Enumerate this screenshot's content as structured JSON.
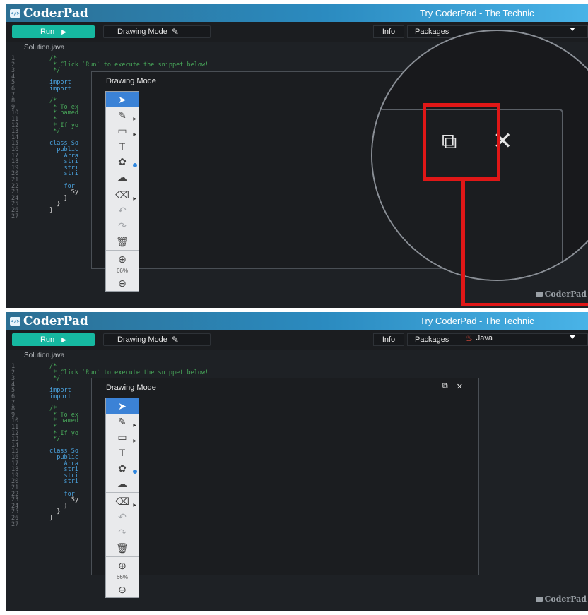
{
  "app": {
    "logo_text": "CoderPad",
    "logo_badge": "</>",
    "tagline": "Try CoderPad - The Technic"
  },
  "toolbar": {
    "run_label": "Run",
    "drawing_label": "Drawing Mode",
    "info_label": "Info",
    "packages_label": "Packages",
    "language": "Java"
  },
  "file_tab": "Solution.java",
  "code_lines": [
    {
      "n": "1",
      "t": "/*",
      "c": "com"
    },
    {
      "n": "2",
      "t": " * Click `Run` to execute the snippet below!",
      "c": "com"
    },
    {
      "n": "3",
      "t": " */",
      "c": "com"
    },
    {
      "n": "4",
      "t": "",
      "c": "pl"
    },
    {
      "n": "5",
      "t": "import",
      "c": "kw"
    },
    {
      "n": "6",
      "t": "import",
      "c": "kw"
    },
    {
      "n": "7",
      "t": "",
      "c": "pl"
    },
    {
      "n": "8",
      "t": "/*",
      "c": "com"
    },
    {
      "n": "9",
      "t": " * To ex",
      "c": "com"
    },
    {
      "n": "10",
      "t": " * named",
      "c": "com"
    },
    {
      "n": "11",
      "t": " *",
      "c": "com"
    },
    {
      "n": "12",
      "t": " * If yo",
      "c": "com"
    },
    {
      "n": "13",
      "t": " */",
      "c": "com"
    },
    {
      "n": "14",
      "t": "",
      "c": "pl"
    },
    {
      "n": "15",
      "t": "class So",
      "c": "kw"
    },
    {
      "n": "16",
      "t": "  public",
      "c": "kw"
    },
    {
      "n": "17",
      "t": "    Arra",
      "c": "kw"
    },
    {
      "n": "18",
      "t": "    stri",
      "c": "kw"
    },
    {
      "n": "19",
      "t": "    stri",
      "c": "kw"
    },
    {
      "n": "20",
      "t": "    stri",
      "c": "kw"
    },
    {
      "n": "21",
      "t": "",
      "c": "pl"
    },
    {
      "n": "22",
      "t": "    for",
      "c": "kw"
    },
    {
      "n": "23",
      "t": "      Sy",
      "c": "pl"
    },
    {
      "n": "24",
      "t": "    }",
      "c": "pl"
    },
    {
      "n": "25",
      "t": "  }",
      "c": "pl"
    },
    {
      "n": "26",
      "t": "}",
      "c": "pl"
    },
    {
      "n": "27",
      "t": "",
      "c": "pl"
    }
  ],
  "drawing_modal": {
    "title": "Drawing Mode",
    "zoom_level": "66%",
    "popout_icon": "popout-icon",
    "close_icon": "close-icon",
    "tools": [
      "select-arrow-icon",
      "pencil-icon",
      "rectangle-icon",
      "text-icon",
      "palette-icon",
      "upload-cloud-icon",
      "eraser-icon",
      "undo-icon",
      "redo-icon",
      "trash-icon",
      "zoom-in-icon",
      "zoom-out-icon"
    ]
  },
  "watermark": "CoderPad",
  "colors": {
    "run": "#16b8a0",
    "highlight": "#e01717",
    "active_tool": "#3b82d6"
  }
}
